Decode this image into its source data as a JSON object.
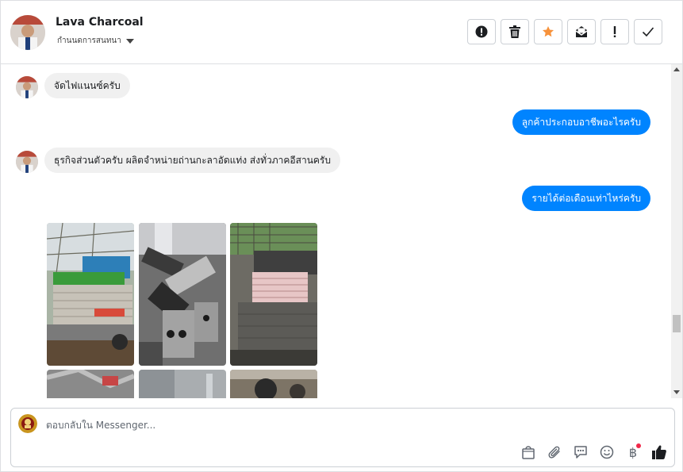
{
  "header": {
    "contact_name": "Lava Charcoal",
    "status_label": "กำนนดการสนทนา",
    "actions": [
      {
        "name": "report-button",
        "icon": "alert-circle-icon"
      },
      {
        "name": "delete-button",
        "icon": "trash-icon"
      },
      {
        "name": "star-button",
        "icon": "star-icon"
      },
      {
        "name": "mark-unread-button",
        "icon": "envelope-icon"
      },
      {
        "name": "important-button",
        "icon": "exclamation-icon"
      },
      {
        "name": "done-button",
        "icon": "check-icon"
      }
    ]
  },
  "colors": {
    "outgoing_bubble": "#0084ff",
    "incoming_bubble": "#f0f0f0",
    "star": "#f7923b",
    "notification_dot": "#f02849"
  },
  "messages": [
    {
      "direction": "in",
      "text": "จัดไฟแนนซ์ครับ"
    },
    {
      "direction": "out",
      "text": "ลูกค้าประกอบอาชีพอะไรครับ"
    },
    {
      "direction": "in",
      "text": "ธุรกิจส่วนตัวครับ ผลิตจำหน่ายถ่านกะลาอัดแท่ง ส่งทั่วภาคอีสานครับ"
    },
    {
      "direction": "out",
      "text": "รายได้ต่อเดือนเท่าไหร่ครับ"
    }
  ],
  "photos": [
    "truck-loaded-photo",
    "charcoal-briquettes-photo",
    "truck-bags-photo",
    "photo-4",
    "photo-5",
    "photo-6"
  ],
  "composer": {
    "placeholder": "ตอบกลับใน Messenger...",
    "tools": [
      "bag-icon",
      "paperclip-icon",
      "saved-replies-icon",
      "emoji-icon",
      "baht-icon",
      "thumbs-up-icon"
    ],
    "baht_symbol": "฿"
  }
}
